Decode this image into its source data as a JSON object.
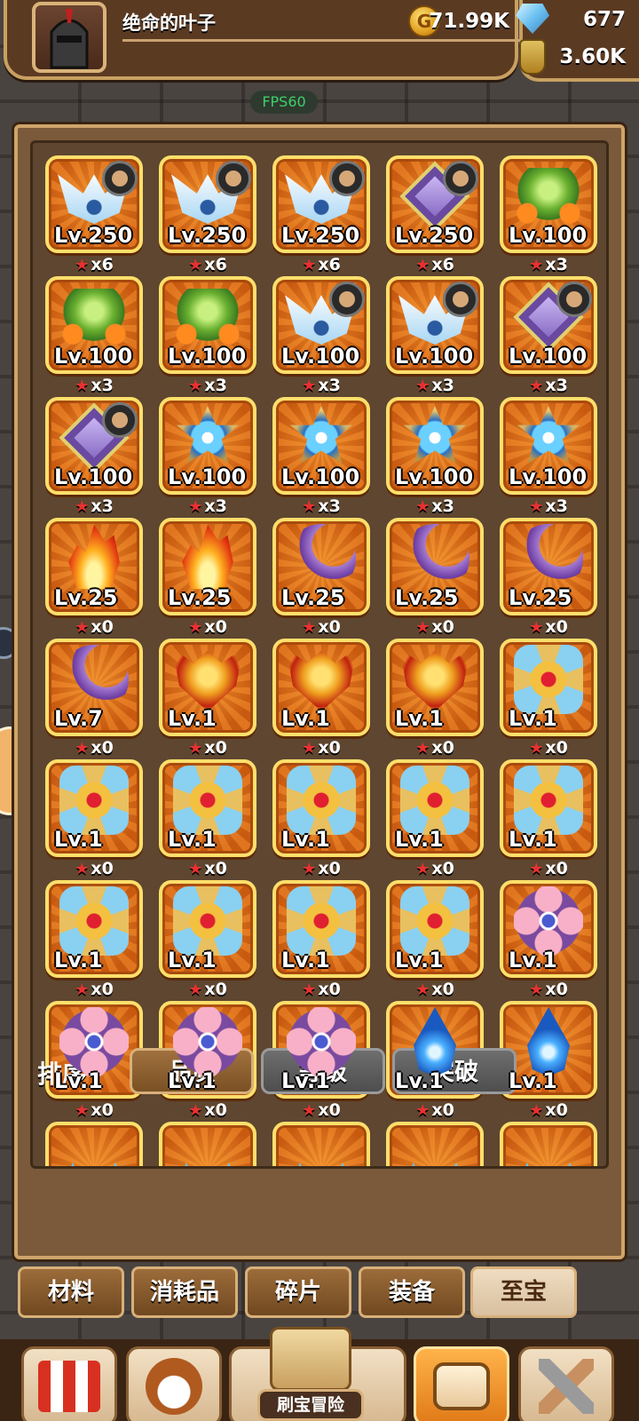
{
  "header": {
    "player_name": "绝命的叶子",
    "gold": "71.99K",
    "gems": "677",
    "potion": "3.60K",
    "fps": "FPS60"
  },
  "grid_items": [
    {
      "art": "wing",
      "level": "Lv.250",
      "stars": "x6",
      "owner": true
    },
    {
      "art": "wing",
      "level": "Lv.250",
      "stars": "x6",
      "owner": true
    },
    {
      "art": "wing",
      "level": "Lv.250",
      "stars": "x6",
      "owner": true
    },
    {
      "art": "diamond",
      "level": "Lv.250",
      "stars": "x6",
      "owner": true
    },
    {
      "art": "plant",
      "level": "Lv.100",
      "stars": "x3",
      "owner": false
    },
    {
      "art": "plant",
      "level": "Lv.100",
      "stars": "x3",
      "owner": false
    },
    {
      "art": "plant",
      "level": "Lv.100",
      "stars": "x3",
      "owner": false
    },
    {
      "art": "wing",
      "level": "Lv.100",
      "stars": "x3",
      "owner": true
    },
    {
      "art": "wing",
      "level": "Lv.100",
      "stars": "x3",
      "owner": true
    },
    {
      "art": "diamond",
      "level": "Lv.100",
      "stars": "x3",
      "owner": true
    },
    {
      "art": "diamond",
      "level": "Lv.100",
      "stars": "x3",
      "owner": true
    },
    {
      "art": "star",
      "level": "Lv.100",
      "stars": "x3",
      "owner": false
    },
    {
      "art": "star",
      "level": "Lv.100",
      "stars": "x3",
      "owner": false
    },
    {
      "art": "star",
      "level": "Lv.100",
      "stars": "x3",
      "owner": false
    },
    {
      "art": "star",
      "level": "Lv.100",
      "stars": "x3",
      "owner": false
    },
    {
      "art": "fire",
      "level": "Lv.25",
      "stars": "x0",
      "owner": false
    },
    {
      "art": "fire",
      "level": "Lv.25",
      "stars": "x0",
      "owner": false
    },
    {
      "art": "moon",
      "level": "Lv.25",
      "stars": "x0",
      "owner": false
    },
    {
      "art": "moon",
      "level": "Lv.25",
      "stars": "x0",
      "owner": false
    },
    {
      "art": "moon",
      "level": "Lv.25",
      "stars": "x0",
      "owner": false
    },
    {
      "art": "moon",
      "level": "Lv.7",
      "stars": "x0",
      "owner": false
    },
    {
      "art": "mask",
      "level": "Lv.1",
      "stars": "x0",
      "owner": false
    },
    {
      "art": "mask",
      "level": "Lv.1",
      "stars": "x0",
      "owner": false
    },
    {
      "art": "mask",
      "level": "Lv.1",
      "stars": "x0",
      "owner": false
    },
    {
      "art": "cross",
      "level": "Lv.1",
      "stars": "x0",
      "owner": false
    },
    {
      "art": "cross",
      "level": "Lv.1",
      "stars": "x0",
      "owner": false
    },
    {
      "art": "cross",
      "level": "Lv.1",
      "stars": "x0",
      "owner": false
    },
    {
      "art": "cross",
      "level": "Lv.1",
      "stars": "x0",
      "owner": false
    },
    {
      "art": "cross",
      "level": "Lv.1",
      "stars": "x0",
      "owner": false
    },
    {
      "art": "cross",
      "level": "Lv.1",
      "stars": "x0",
      "owner": false
    },
    {
      "art": "cross",
      "level": "Lv.1",
      "stars": "x0",
      "owner": false
    },
    {
      "art": "cross",
      "level": "Lv.1",
      "stars": "x0",
      "owner": false
    },
    {
      "art": "cross",
      "level": "Lv.1",
      "stars": "x0",
      "owner": false
    },
    {
      "art": "cross",
      "level": "Lv.1",
      "stars": "x0",
      "owner": false
    },
    {
      "art": "flower",
      "level": "Lv.1",
      "stars": "x0",
      "owner": false
    },
    {
      "art": "flower",
      "level": "Lv.1",
      "stars": "x0",
      "owner": false
    },
    {
      "art": "flower",
      "level": "Lv.1",
      "stars": "x0",
      "owner": false
    },
    {
      "art": "flower",
      "level": "Lv.1",
      "stars": "x0",
      "owner": false
    },
    {
      "art": "drop",
      "level": "Lv.1",
      "stars": "x0",
      "owner": false
    },
    {
      "art": "drop",
      "level": "Lv.1",
      "stars": "x0",
      "owner": false
    },
    {
      "art": "tri",
      "level": "",
      "stars": "",
      "owner": false
    },
    {
      "art": "tri",
      "level": "",
      "stars": "",
      "owner": false
    },
    {
      "art": "tri",
      "level": "",
      "stars": "",
      "owner": false
    },
    {
      "art": "tri",
      "level": "",
      "stars": "",
      "owner": false
    },
    {
      "art": "tri",
      "level": "",
      "stars": "",
      "owner": false
    }
  ],
  "sort": {
    "label": "排序",
    "options": [
      "品质",
      "等级",
      "突破"
    ],
    "active": 0
  },
  "categories": {
    "tabs": [
      "材料",
      "消耗品",
      "碎片",
      "装备",
      "至宝"
    ],
    "selected": 4
  },
  "nav": {
    "adventure_label": "刷宝冒险",
    "selected_index": 3
  }
}
